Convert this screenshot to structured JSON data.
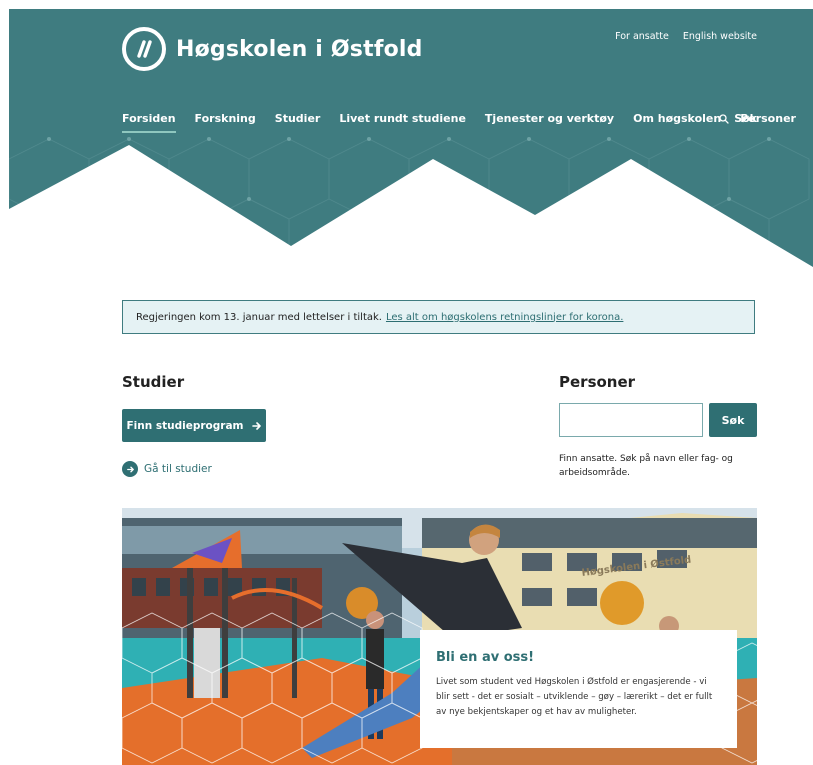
{
  "brand": {
    "name": "Høgskolen i Østfold",
    "logo_icon": "hiof-logo-icon",
    "primary_color": "#3f7c80",
    "button_color": "#2f6f73"
  },
  "top_links": [
    "For ansatte",
    "English website"
  ],
  "nav": {
    "items": [
      {
        "label": "Forsiden",
        "active": true
      },
      {
        "label": "Forskning",
        "active": false
      },
      {
        "label": "Studier",
        "active": false
      },
      {
        "label": "Livet rundt studiene",
        "active": false
      },
      {
        "label": "Tjenester og verktøy",
        "active": false
      },
      {
        "label": "Om høgskolen",
        "active": false
      },
      {
        "label": "Personer",
        "active": false
      }
    ],
    "search_label": "Søk",
    "search_icon": "search-icon"
  },
  "notice": {
    "text": "Regjeringen kom 13. januar med lettelser i tiltak.",
    "link": "Les alt om høgskolens retningslinjer for korona."
  },
  "studier": {
    "title": "Studier",
    "button_label": "Finn studieprogram",
    "link_label": "Gå til studier"
  },
  "personer": {
    "title": "Personer",
    "input_value": "",
    "input_placeholder": "",
    "button_label": "Søk",
    "help_text": "Finn ansatte. Søk på navn eller fag- og arbeidsområde."
  },
  "hero": {
    "image_text": "Høgskolen i Østfold",
    "card_title": "Bli en av oss!",
    "card_text": "Livet som student ved Høgskolen i Østfold er engasjerende - vi blir sett - det er sosialt – utviklende – gøy – lærerikt – det er fullt av nye bekjentskaper og et hav av muligheter."
  }
}
